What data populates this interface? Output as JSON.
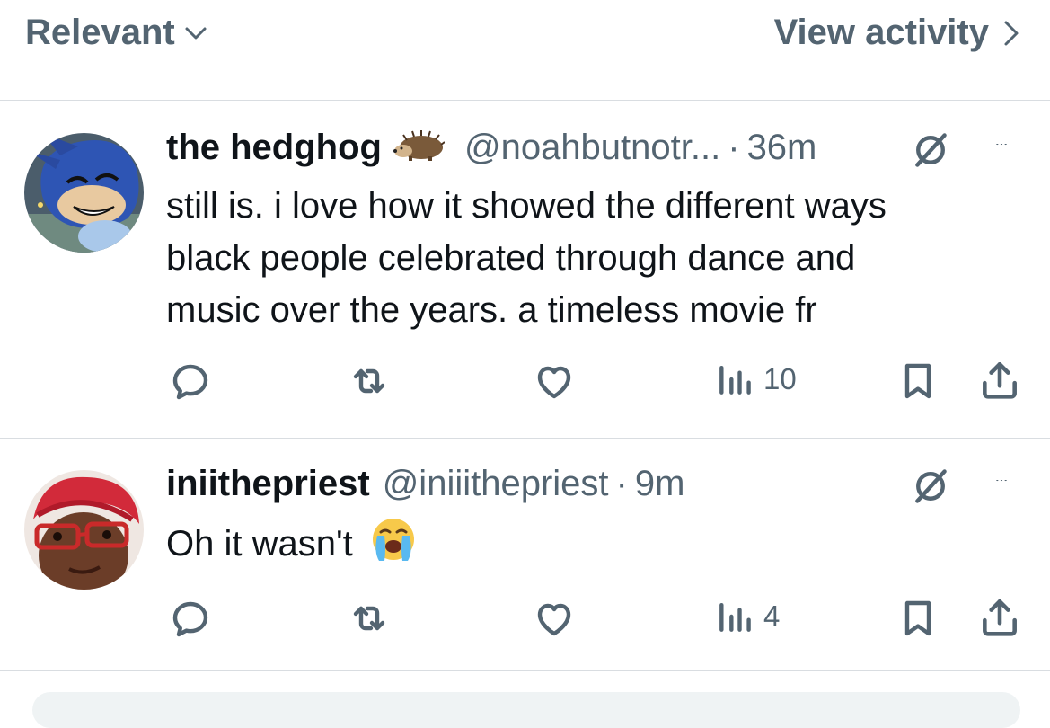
{
  "header": {
    "sort_label": "Relevant",
    "activity_label": "View activity"
  },
  "colors": {
    "text_primary": "#0f1419",
    "text_secondary": "#536471",
    "divider": "#d9dde1"
  },
  "tweets": [
    {
      "name": "the hedghog",
      "name_emoji": "hedgehog",
      "handle": "@noahbutnotr...",
      "time": "36m",
      "lines": [
        "still is. i love how it showed the different ways",
        "black people celebrated through dance and",
        "music over the years. a timeless movie fr"
      ],
      "views": "10"
    },
    {
      "name": "iniithepriest",
      "handle": "@iniiithepriest",
      "time": "9m",
      "text": "Oh it wasn't",
      "text_emoji": "loudly-crying-face",
      "views": "4"
    }
  ],
  "icons": [
    "chevron-down-icon",
    "chevron-right-icon",
    "reply-icon",
    "retweet-icon",
    "like-icon",
    "views-icon",
    "bookmark-icon",
    "share-icon",
    "mute-icon",
    "more-icon"
  ]
}
